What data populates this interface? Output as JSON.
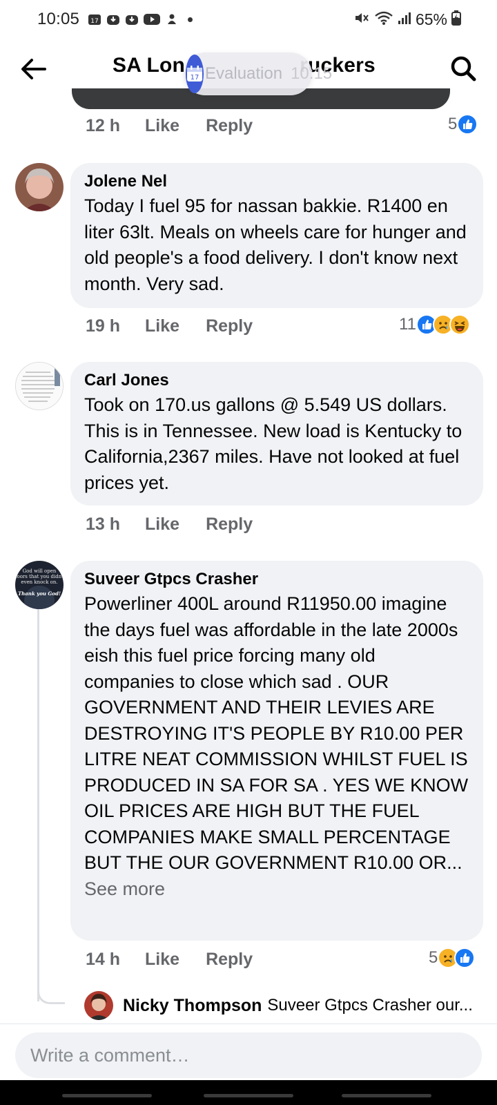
{
  "status_bar": {
    "time": "10:05",
    "calendar_day": "17",
    "battery": "65%"
  },
  "header": {
    "title": "SA Long Distance Truckers",
    "title_left": "SA Lon",
    "title_right": "ruckers"
  },
  "notification": {
    "icon_day": "17",
    "text": "Evaluation",
    "time": "10:15"
  },
  "previous_comment": {
    "time": "12 h",
    "like": "Like",
    "reply": "Reply",
    "reaction_count": "5",
    "reactions": [
      "like"
    ]
  },
  "comments": [
    {
      "author": "Jolene Nel",
      "text": "Today I fuel 95 for nassan bakkie. R1400 en liter 63lt. Meals on wheels care for hunger and old people's a food delivery. I don't know next month. Very sad.",
      "time": "19 h",
      "like": "Like",
      "reply": "Reply",
      "reaction_count": "11",
      "reactions": [
        "like",
        "sad",
        "haha"
      ]
    },
    {
      "author": "Carl Jones",
      "text": "Took on 170.us gallons @ 5.549 US dollars. This is in Tennessee. New load is Kentucky to California,2367 miles. Have not looked at fuel prices yet.",
      "time": "13 h",
      "like": "Like",
      "reply": "Reply"
    },
    {
      "author": "Suveer Gtpcs Crasher",
      "text": "Powerliner 400L around R11950.00 imagine the days fuel was affordable in the late 2000s eish this fuel price forcing many old companies to close which sad . OUR GOVERNMENT AND THEIR LEVIES ARE DESTROYING IT'S PEOPLE BY R10.00 PER LITRE NEAT COMMISSION WHILST FUEL IS PRODUCED IN SA FOR SA . YES WE KNOW OIL PRICES ARE HIGH BUT THE FUEL COMPANIES MAKE SMALL PERCENTAGE BUT THE OUR GOVERNMENT R10.00 OR...",
      "see_more": "See more",
      "time": "14 h",
      "like": "Like",
      "reply": "Reply",
      "reaction_count": "5",
      "reactions": [
        "sad",
        "like"
      ],
      "avatar_text": [
        "God will open",
        "doors that you didn't",
        "even knock on.",
        "Thank you God!"
      ]
    }
  ],
  "reply_preview": {
    "author": "Nicky Thompson",
    "snippet": "Suveer Gtpcs Crasher our..."
  },
  "composer": {
    "placeholder": "Write a comment…"
  }
}
